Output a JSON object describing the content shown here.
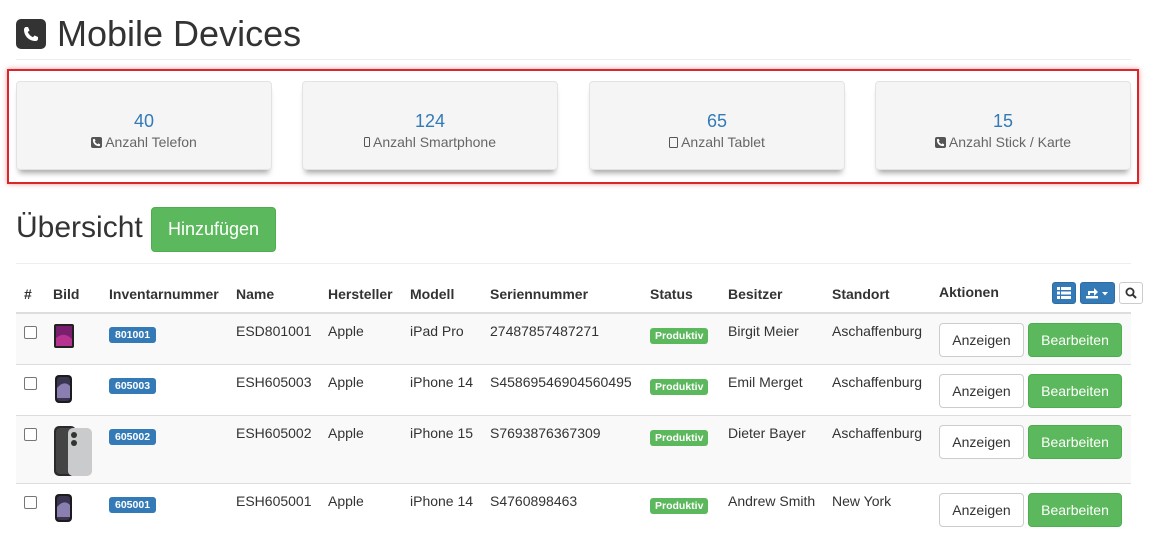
{
  "header": {
    "title": "Mobile Devices",
    "icon": "phone-square-icon"
  },
  "stats": [
    {
      "value": "40",
      "label": "Anzahl Telefon",
      "icon": "phone-icon"
    },
    {
      "value": "124",
      "label": "Anzahl Smartphone",
      "icon": "mobile-icon"
    },
    {
      "value": "65",
      "label": "Anzahl Tablet",
      "icon": "tablet-icon"
    },
    {
      "value": "15",
      "label": "Anzahl Stick / Karte",
      "icon": "phone-icon"
    }
  ],
  "overview": {
    "title": "Übersicht",
    "add_label": "Hinzufügen"
  },
  "table": {
    "columns": [
      "#",
      "Bild",
      "Inventarnummer",
      "Name",
      "Hersteller",
      "Modell",
      "Seriennummer",
      "Status",
      "Besitzer",
      "Standort",
      "Aktionen"
    ],
    "tools": [
      "list-view-icon",
      "export-icon",
      "search-icon"
    ],
    "rows": [
      {
        "inventory": "801001",
        "name": "ESD801001",
        "manufacturer": "Apple",
        "model": "iPad Pro",
        "serial": "27487857487271",
        "status": "Produktiv",
        "owner": "Birgit Meier",
        "location": "Aschaffenburg",
        "view": "Anzeigen",
        "edit": "Bearbeiten",
        "image": "ipad-pro-image"
      },
      {
        "inventory": "605003",
        "name": "ESH605003",
        "manufacturer": "Apple",
        "model": "iPhone 14",
        "serial": "S45869546904560495",
        "status": "Produktiv",
        "owner": "Emil Merget",
        "location": "Aschaffenburg",
        "view": "Anzeigen",
        "edit": "Bearbeiten",
        "image": "iphone-14-image"
      },
      {
        "inventory": "605002",
        "name": "ESH605002",
        "manufacturer": "Apple",
        "model": "iPhone 15",
        "serial": "S7693876367309",
        "status": "Produktiv",
        "owner": "Dieter Bayer",
        "location": "Aschaffenburg",
        "view": "Anzeigen",
        "edit": "Bearbeiten",
        "image": "iphone-15-image"
      },
      {
        "inventory": "605001",
        "name": "ESH605001",
        "manufacturer": "Apple",
        "model": "iPhone 14",
        "serial": "S4760898463",
        "status": "Produktiv",
        "owner": "Andrew Smith",
        "location": "New York",
        "view": "Anzeigen",
        "edit": "Bearbeiten",
        "image": "iphone-14-image"
      }
    ]
  },
  "colors": {
    "primary": "#337ab7",
    "success": "#5cb85c",
    "highlight_frame": "#d9262a"
  }
}
